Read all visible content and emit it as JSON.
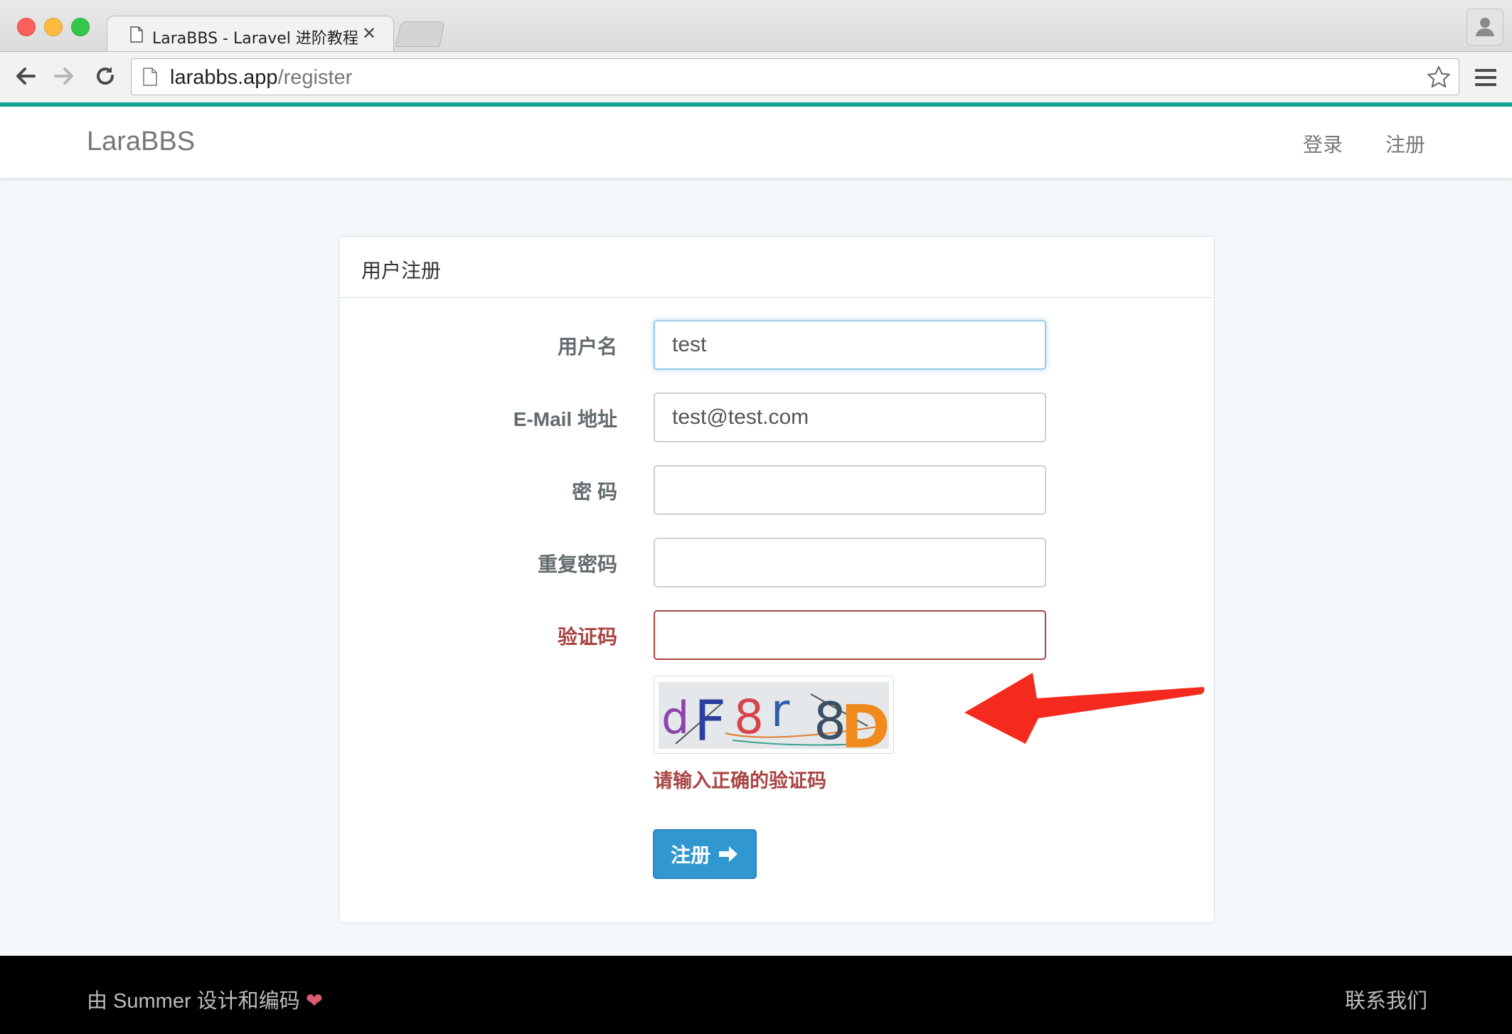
{
  "browser": {
    "tab_title": "LaraBBS - Laravel 进阶教程",
    "tab_close": "✕",
    "url_host": "larabbs.app",
    "url_path": "/register",
    "accent_color": "#12a697"
  },
  "navbar": {
    "brand": "LaraBBS",
    "login_label": "登录",
    "register_label": "注册"
  },
  "card": {
    "title": "用户注册"
  },
  "form": {
    "name_label": "用户名",
    "name_value": "test",
    "email_label": "E-Mail 地址",
    "email_value": "test@test.com",
    "password_label": "密 码",
    "password_confirm_label": "重复密码",
    "captcha_label": "验证码",
    "captcha_text": "dF8r8D",
    "captcha_error": "请输入正确的验证码",
    "submit_label": "注册"
  },
  "footer": {
    "credit": "由 Summer 设计和编码",
    "heart": "❤",
    "contact": "联系我们"
  },
  "colors": {
    "primary": "#3097d1",
    "error": "#a94442",
    "annotation_arrow": "#f52a1e"
  }
}
